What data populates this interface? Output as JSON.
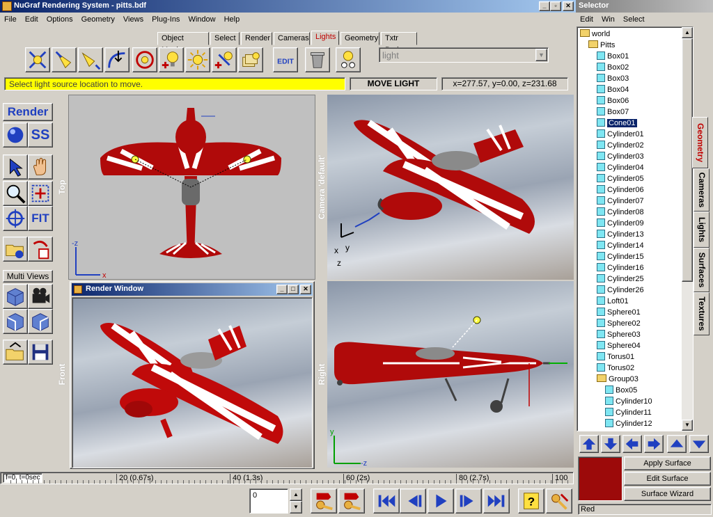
{
  "main_window": {
    "title": "NuGraf Rendering System - pitts.bdf",
    "menu": [
      "File",
      "Edit",
      "Options",
      "Geometry",
      "Views",
      "Plug-Ins",
      "Window",
      "Help"
    ]
  },
  "tabs": [
    "Object Manip",
    "Select",
    "Render",
    "Cameras",
    "Lights",
    "Geometry",
    "Txtr Proj"
  ],
  "active_tab": "Lights",
  "toolbar": {
    "icons": [
      "light-direction-icon",
      "spotlight-icon",
      "spotlight-aim-icon",
      "light-target-icon",
      "light-position-icon",
      "add-point-light-icon",
      "sun-light-icon",
      "add-light-icon",
      "light-list-icon",
      "edit-light-icon",
      "delete-light-icon",
      "light-settings-icon"
    ],
    "edit_label": "EDIT",
    "light_select_value": "light"
  },
  "status": {
    "message": "Select light source location to move.",
    "mode": "MOVE LIGHT",
    "coords": "x=277.57, y=0.00, z=231.68"
  },
  "left_panel": {
    "render_label": "Render",
    "ss_label": "SS",
    "fit_label": "FIT",
    "multi_views_label": "Multi Views"
  },
  "viewports": {
    "top": "Top",
    "camera": "Camera 'default'",
    "front": "Front",
    "right": "Right",
    "render_window_title": "Render Window"
  },
  "axes": {
    "top_x": "x",
    "top_z": "-z",
    "cam_x": "x",
    "cam_y": "y",
    "cam_z": "z",
    "right_y": "y",
    "right_z": "-z"
  },
  "timeline": {
    "current": "f=0, t=0sec",
    "ticks": [
      "20 (0.67s)",
      "40 (1.3s)",
      "60 (2s)",
      "80 (2.7s)",
      "100"
    ]
  },
  "playback": {
    "frame_value": "0"
  },
  "selector": {
    "title": "Selector",
    "menu": [
      "Edit",
      "Win",
      "Select"
    ],
    "tree": [
      {
        "label": "world",
        "level": 0,
        "type": "folder"
      },
      {
        "label": "Pitts",
        "level": 1,
        "type": "folder"
      },
      {
        "label": "Box01",
        "level": 2,
        "type": "obj"
      },
      {
        "label": "Box02",
        "level": 2,
        "type": "obj"
      },
      {
        "label": "Box03",
        "level": 2,
        "type": "obj"
      },
      {
        "label": "Box04",
        "level": 2,
        "type": "obj"
      },
      {
        "label": "Box06",
        "level": 2,
        "type": "obj"
      },
      {
        "label": "Box07",
        "level": 2,
        "type": "obj"
      },
      {
        "label": "Cone01",
        "level": 2,
        "type": "obj",
        "selected": true
      },
      {
        "label": "Cylinder01",
        "level": 2,
        "type": "obj"
      },
      {
        "label": "Cylinder02",
        "level": 2,
        "type": "obj"
      },
      {
        "label": "Cylinder03",
        "level": 2,
        "type": "obj"
      },
      {
        "label": "Cylinder04",
        "level": 2,
        "type": "obj"
      },
      {
        "label": "Cylinder05",
        "level": 2,
        "type": "obj"
      },
      {
        "label": "Cylinder06",
        "level": 2,
        "type": "obj"
      },
      {
        "label": "Cylinder07",
        "level": 2,
        "type": "obj"
      },
      {
        "label": "Cylinder08",
        "level": 2,
        "type": "obj"
      },
      {
        "label": "Cylinder09",
        "level": 2,
        "type": "obj"
      },
      {
        "label": "Cylinder13",
        "level": 2,
        "type": "obj"
      },
      {
        "label": "Cylinder14",
        "level": 2,
        "type": "obj"
      },
      {
        "label": "Cylinder15",
        "level": 2,
        "type": "obj"
      },
      {
        "label": "Cylinder16",
        "level": 2,
        "type": "obj"
      },
      {
        "label": "Cylinder25",
        "level": 2,
        "type": "obj"
      },
      {
        "label": "Cylinder26",
        "level": 2,
        "type": "obj"
      },
      {
        "label": "Loft01",
        "level": 2,
        "type": "obj"
      },
      {
        "label": "Sphere01",
        "level": 2,
        "type": "obj"
      },
      {
        "label": "Sphere02",
        "level": 2,
        "type": "obj"
      },
      {
        "label": "Sphere03",
        "level": 2,
        "type": "obj"
      },
      {
        "label": "Sphere04",
        "level": 2,
        "type": "obj"
      },
      {
        "label": "Torus01",
        "level": 2,
        "type": "obj"
      },
      {
        "label": "Torus02",
        "level": 2,
        "type": "obj"
      },
      {
        "label": "Group03",
        "level": 2,
        "type": "folder"
      },
      {
        "label": "Box05",
        "level": 3,
        "type": "obj"
      },
      {
        "label": "Cylinder10",
        "level": 3,
        "type": "obj"
      },
      {
        "label": "Cylinder11",
        "level": 3,
        "type": "obj"
      },
      {
        "label": "Cylinder12",
        "level": 3,
        "type": "obj"
      }
    ],
    "vertical_tabs": [
      "Geometry",
      "Cameras",
      "Lights",
      "Surfaces",
      "Textures"
    ],
    "active_vertical_tab": "Geometry",
    "surface_buttons": [
      "Apply Surface",
      "Edit Surface",
      "Surface Wizard"
    ],
    "surface_name": "Red",
    "surface_color": "#9c0a0a"
  },
  "colors": {
    "accent_red": "#c00000",
    "plane_red": "#b00a0a",
    "status_yellow": "#ffff00"
  }
}
